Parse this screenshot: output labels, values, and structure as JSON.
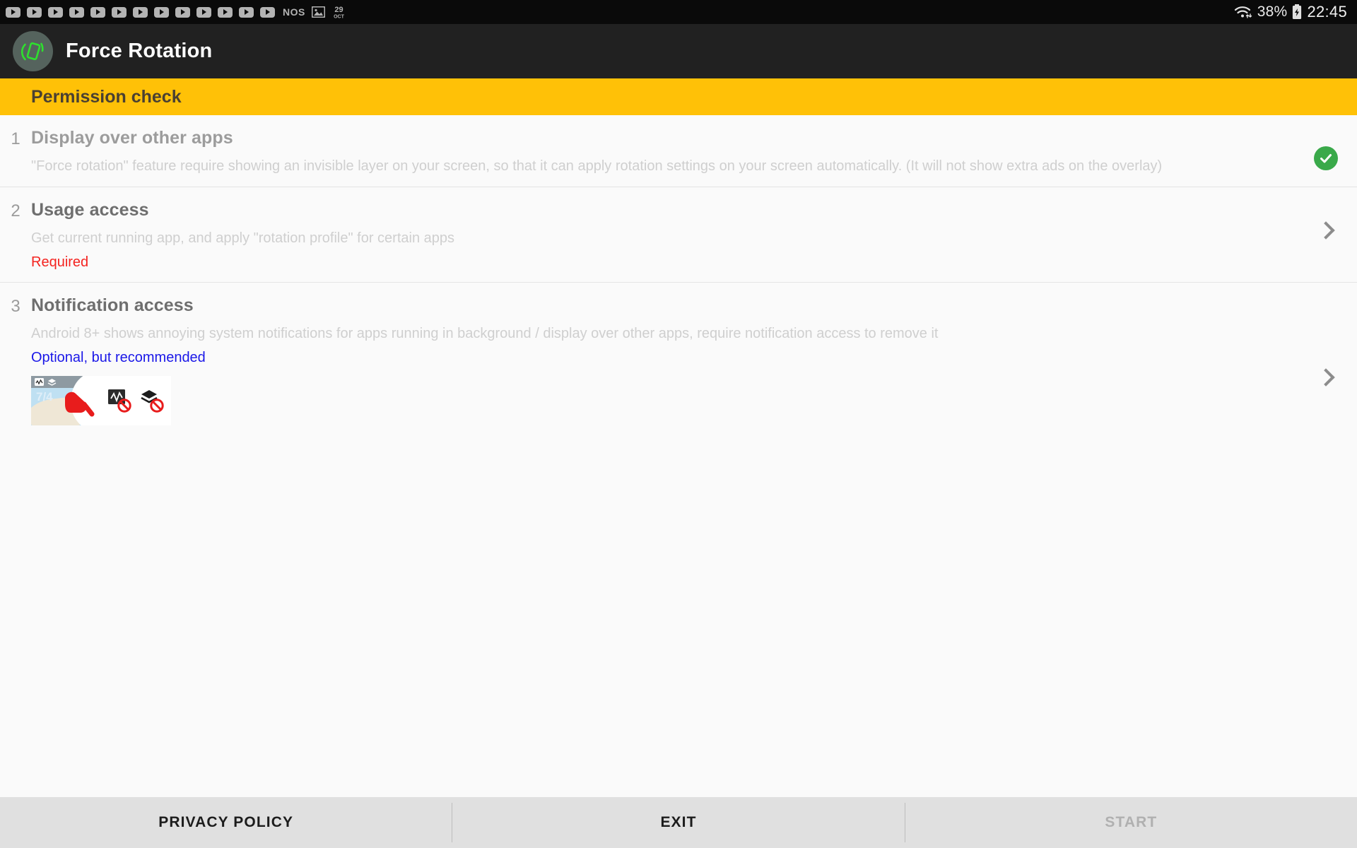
{
  "status_bar": {
    "notification_icons": [
      "play-chip-icon",
      "play-chip-icon",
      "play-chip-icon",
      "play-chip-icon",
      "play-chip-icon",
      "play-chip-icon",
      "play-chip-icon",
      "play-chip-icon",
      "play-chip-icon",
      "play-chip-icon",
      "play-chip-icon",
      "play-chip-icon",
      "play-chip-icon"
    ],
    "nos_label": "NOS",
    "image_icon": "image-icon",
    "calendar_icon": "calendar-icon",
    "calendar_day": "29",
    "calendar_month": "OCT",
    "wifi_icon": "wifi-icon",
    "battery_percent": "38%",
    "battery_icon": "battery-charging-icon",
    "clock": "22:45"
  },
  "app_bar": {
    "icon": "force-rotation-app-icon",
    "title": "Force Rotation",
    "icon_color": "#2ee02e",
    "icon_bg": "#55635d"
  },
  "banner": {
    "title": "Permission check",
    "bg_color": "#ffc107",
    "text_color": "#4a4032"
  },
  "permissions": [
    {
      "number": "1",
      "title": "Display over other apps",
      "description": "\"Force rotation\" feature require showing an invisible layer on your screen, so that it can apply rotation settings on your screen automatically. (It will not show extra ads on the overlay)",
      "status": "",
      "trailing": "check-badge",
      "granted": true
    },
    {
      "number": "2",
      "title": "Usage access",
      "description": "Get current running app, and apply \"rotation profile\" for certain apps",
      "status": "Required",
      "status_color": "#f4231f",
      "trailing": "chevron",
      "granted": false
    },
    {
      "number": "3",
      "title": "Notification access",
      "description": "Android 8+ shows annoying system notifications for apps running in background / display over other apps, require notification access to remove it",
      "status": "Optional, but recommended",
      "status_color": "#1a17e8",
      "trailing": "chevron",
      "granted": false
    }
  ],
  "thumbnails": {
    "map_label": "7/4",
    "items": [
      "map-screenshot-thumbnail",
      "icons-screenshot-thumbnail"
    ]
  },
  "bottom_bar": {
    "privacy_label": "PRIVACY POLICY",
    "exit_label": "EXIT",
    "start_label": "START",
    "start_disabled": true
  }
}
